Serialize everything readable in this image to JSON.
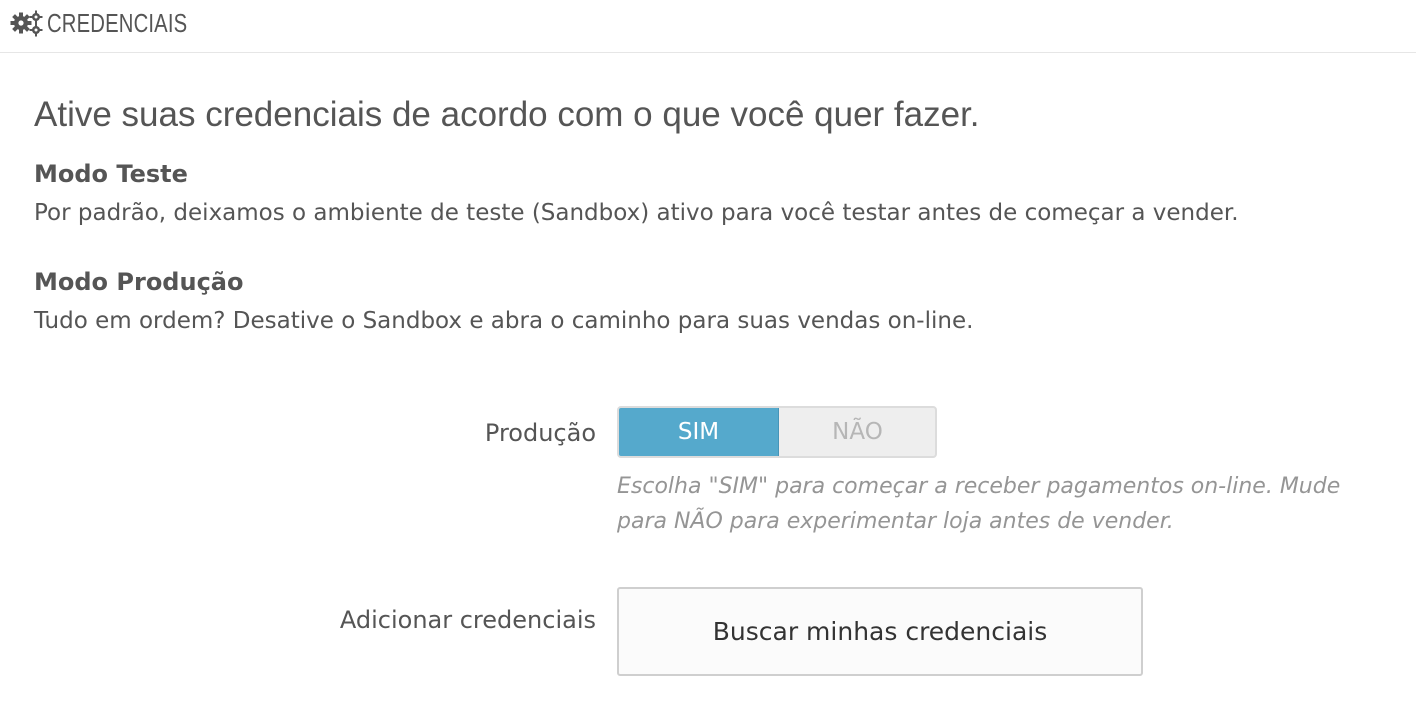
{
  "header": {
    "icon": "gears-icon",
    "title": "CREDENCIAIS"
  },
  "intro": "Ative suas credenciais de acordo com o que você quer fazer.",
  "modes": [
    {
      "title": "Modo Teste",
      "description": "Por padrão, deixamos o ambiente de teste (Sandbox) ativo para você testar antes de começar a vender."
    },
    {
      "title": "Modo Produção",
      "description": "Tudo em ordem? Desative o Sandbox e abra o caminho para suas vendas on-line."
    }
  ],
  "production": {
    "label": "Produção",
    "yes_label": "SIM",
    "no_label": "NÃO",
    "selected": "SIM",
    "active_color": "#55a9cc",
    "help": "Escolha \"SIM\" para começar a receber pagamentos on-line. Mude para NÃO para experimentar loja antes de vender."
  },
  "credentials": {
    "label": "Adicionar credenciais",
    "button_label": "Buscar minhas credenciais"
  }
}
